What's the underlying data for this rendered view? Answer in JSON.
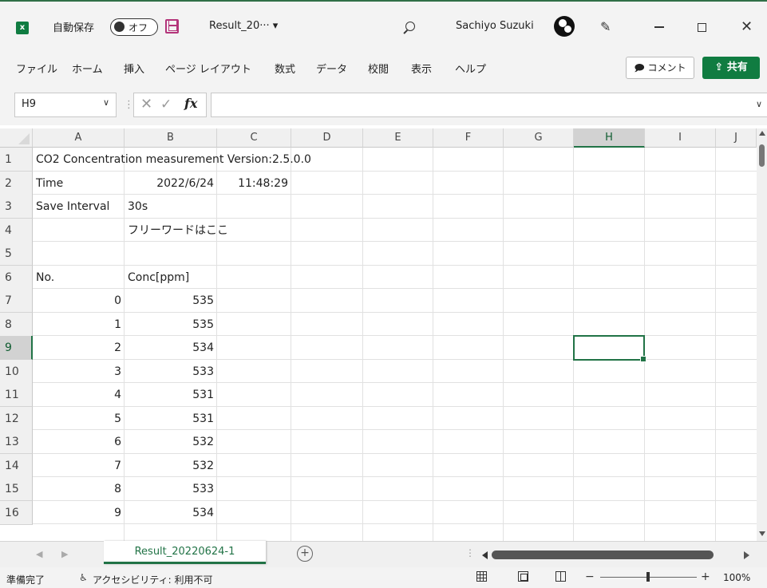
{
  "titlebar": {
    "app_icon": "x",
    "autosave_label": "自動保存",
    "autosave_state": "オフ",
    "filename": "Result_20··· ▾",
    "user_name": "Sachiyo Suzuki"
  },
  "ribbon": {
    "tabs": [
      "ファイル",
      "ホーム",
      "挿入",
      "ページ レイアウト",
      "数式",
      "データ",
      "校閲",
      "表示",
      "ヘルプ"
    ],
    "comment_label": "🗩 コメント",
    "share_label": "⇪ 共有"
  },
  "formula_bar": {
    "name_box": "H9",
    "fx": "fx",
    "value": ""
  },
  "columns": [
    "A",
    "B",
    "C",
    "D",
    "E",
    "F",
    "G",
    "H",
    "I",
    "J"
  ],
  "rows": [
    "1",
    "2",
    "3",
    "4",
    "5",
    "6",
    "7",
    "8",
    "9",
    "10",
    "11",
    "12",
    "13",
    "14",
    "15",
    "16"
  ],
  "selected_cell": "H9",
  "cells": {
    "A1": "CO2 Concentration measurement Version:2.5.0.0",
    "A2": "Time",
    "B2": "2022/6/24",
    "C2": "11:48:29",
    "A3": "Save Interval",
    "B3": "30s",
    "B4": "フリーワードはここ",
    "A6": "No.",
    "B6": "Conc[ppm]",
    "A7": "0",
    "B7": "535",
    "A8": "1",
    "B8": "535",
    "A9": "2",
    "B9": "534",
    "A10": "3",
    "B10": "533",
    "A11": "4",
    "B11": "531",
    "A12": "5",
    "B12": "531",
    "A13": "6",
    "B13": "532",
    "A14": "7",
    "B14": "532",
    "A15": "8",
    "B15": "533",
    "A16": "9",
    "B16": "534"
  },
  "sheet_tabs": [
    "Result_20220624-1"
  ],
  "add_sheet": "+",
  "status": {
    "ready": "準備完了",
    "accessibility": "アクセシビリティ: 利用不可",
    "zoom": "100%"
  },
  "colors": {
    "accent": "#217346",
    "share_button": "#107c41",
    "save_icon": "#b3347a"
  }
}
